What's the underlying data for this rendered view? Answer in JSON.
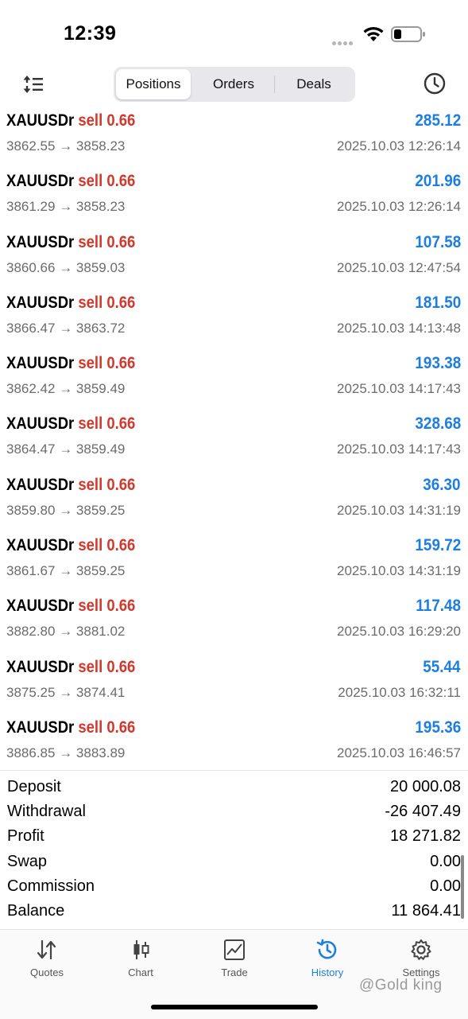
{
  "status_bar": {
    "time": "12:39"
  },
  "toolbar": {
    "tabs": [
      {
        "label": "Positions",
        "active": true
      },
      {
        "label": "Orders",
        "active": false
      },
      {
        "label": "Deals",
        "active": false
      }
    ],
    "icons": {
      "sort": "sort-icon",
      "history": "clock-icon"
    }
  },
  "deals": [
    {
      "symbol": "XAUUSDr",
      "direction": "sell 0.66",
      "profit": "285.12",
      "open_price": "3862.55",
      "close_price": "3858.23",
      "time": "2025.10.03 12:26:14"
    },
    {
      "symbol": "XAUUSDr",
      "direction": "sell 0.66",
      "profit": "201.96",
      "open_price": "3861.29",
      "close_price": "3858.23",
      "time": "2025.10.03 12:26:14"
    },
    {
      "symbol": "XAUUSDr",
      "direction": "sell 0.66",
      "profit": "107.58",
      "open_price": "3860.66",
      "close_price": "3859.03",
      "time": "2025.10.03 12:47:54"
    },
    {
      "symbol": "XAUUSDr",
      "direction": "sell 0.66",
      "profit": "181.50",
      "open_price": "3866.47",
      "close_price": "3863.72",
      "time": "2025.10.03 14:13:48"
    },
    {
      "symbol": "XAUUSDr",
      "direction": "sell 0.66",
      "profit": "193.38",
      "open_price": "3862.42",
      "close_price": "3859.49",
      "time": "2025.10.03 14:17:43"
    },
    {
      "symbol": "XAUUSDr",
      "direction": "sell 0.66",
      "profit": "328.68",
      "open_price": "3864.47",
      "close_price": "3859.49",
      "time": "2025.10.03 14:17:43"
    },
    {
      "symbol": "XAUUSDr",
      "direction": "sell 0.66",
      "profit": "36.30",
      "open_price": "3859.80",
      "close_price": "3859.25",
      "time": "2025.10.03 14:31:19"
    },
    {
      "symbol": "XAUUSDr",
      "direction": "sell 0.66",
      "profit": "159.72",
      "open_price": "3861.67",
      "close_price": "3859.25",
      "time": "2025.10.03 14:31:19"
    },
    {
      "symbol": "XAUUSDr",
      "direction": "sell 0.66",
      "profit": "117.48",
      "open_price": "3882.80",
      "close_price": "3881.02",
      "time": "2025.10.03 16:29:20"
    },
    {
      "symbol": "XAUUSDr",
      "direction": "sell 0.66",
      "profit": "55.44",
      "open_price": "3875.25",
      "close_price": "3874.41",
      "time": "2025.10.03 16:32:11"
    },
    {
      "symbol": "XAUUSDr",
      "direction": "sell 0.66",
      "profit": "195.36",
      "open_price": "3886.85",
      "close_price": "3883.89",
      "time": "2025.10.03 16:46:57"
    }
  ],
  "arrow": "→",
  "summary": [
    {
      "label": "Deposit",
      "value": "20 000.08"
    },
    {
      "label": "Withdrawal",
      "value": "-26 407.49"
    },
    {
      "label": "Profit",
      "value": "18 271.82"
    },
    {
      "label": "Swap",
      "value": "0.00"
    },
    {
      "label": "Commission",
      "value": "0.00"
    },
    {
      "label": "Balance",
      "value": "11 864.41"
    }
  ],
  "tabbar": [
    {
      "label": "Quotes",
      "icon": "quotes-icon",
      "active": false
    },
    {
      "label": "Chart",
      "icon": "candlestick-chart-icon",
      "active": false
    },
    {
      "label": "Trade",
      "icon": "trade-chart-icon",
      "active": false
    },
    {
      "label": "History",
      "icon": "history-icon",
      "active": true
    },
    {
      "label": "Settings",
      "icon": "gear-icon",
      "active": false
    }
  ],
  "watermark": "@Gold king",
  "colors": {
    "accent": "#1e7ee0",
    "sell": "#d2382c",
    "muted": "#6b6b6b"
  }
}
